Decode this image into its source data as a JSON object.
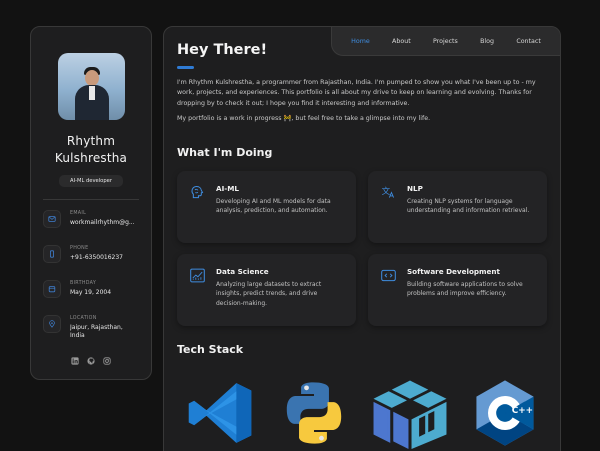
{
  "profile": {
    "name_line1": "Rhythm",
    "name_line2": "Kulshrestha",
    "title": "AI-ML developer"
  },
  "contacts": [
    {
      "label": "EMAIL",
      "value": "workmailrhythm@g...",
      "icon": "mail-icon"
    },
    {
      "label": "PHONE",
      "value": "+91-6350016237",
      "icon": "phone-icon"
    },
    {
      "label": "BIRTHDAY",
      "value": "May 19, 2004",
      "icon": "calendar-icon"
    },
    {
      "label": "LOCATION",
      "value": "Jaipur, Rajasthan, India",
      "icon": "location-pin-icon"
    }
  ],
  "socials": [
    "linkedin-icon",
    "github-icon",
    "instagram-icon"
  ],
  "nav": [
    "Home",
    "About",
    "Projects",
    "Blog",
    "Contact"
  ],
  "main": {
    "title": "Hey There!",
    "about_p1": "I'm Rhythm Kulshrestha, a programmer from Rajasthan, India. I'm pumped to show you what I've been up to - my work, projects, and experiences. This portfolio is all about my drive to keep on learning and evolving. Thanks for dropping by to check it out; I hope you find it interesting and informative.",
    "about_p2_before": "My portfolio is a work in progress ",
    "about_p2_emoji": "🚧",
    "about_p2_after": ", but feel free to take a glimpse into my life.",
    "doing_title": "What I'm Doing",
    "services": [
      {
        "name": "AI-ML",
        "desc": "Developing AI and ML models for data analysis, prediction, and automation.",
        "icon": "brain-icon"
      },
      {
        "name": "NLP",
        "desc": "Creating NLP systems for language understanding and information retrieval.",
        "icon": "language-icon"
      },
      {
        "name": "Data Science",
        "desc": "Analyzing large datasets to extract insights, predict trends, and drive decision-making.",
        "icon": "chart-icon"
      },
      {
        "name": "Software Development",
        "desc": "Building software applications to solve problems and improve efficiency.",
        "icon": "code-window-icon"
      }
    ],
    "tech_title": "Tech Stack",
    "tech_stack": [
      "vscode-logo",
      "python-logo",
      "numpy-logo",
      "cplusplus-logo"
    ],
    "cplusplus_text": "C++"
  },
  "colors": {
    "accent": "#3f8de0",
    "background": "#121212",
    "card": "#1e1e1f"
  }
}
